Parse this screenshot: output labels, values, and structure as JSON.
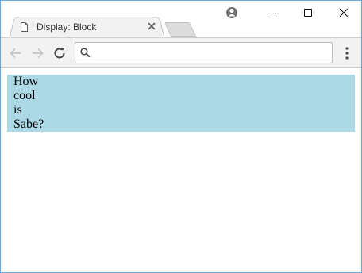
{
  "tab": {
    "title": "Display: Block"
  },
  "omnibox": {
    "value": "",
    "placeholder": ""
  },
  "page": {
    "words": [
      "How",
      "cool",
      "is",
      "Sabe?"
    ]
  },
  "colors": {
    "block_background": "#add8e6",
    "window_border": "#6fa6d6"
  }
}
